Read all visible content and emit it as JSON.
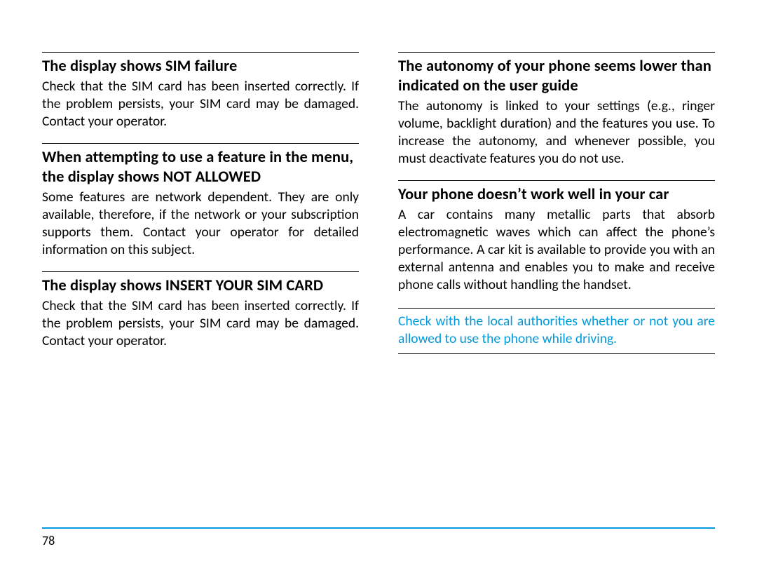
{
  "page_number": "78",
  "left": {
    "sections": [
      {
        "heading": "The display shows SIM failure",
        "body": "Check that the SIM card has been inserted correctly. If the problem persists, your SIM card may be damaged. Contact your operator."
      },
      {
        "heading": "When attempting to use a feature in the menu, the display shows NOT ALLOWED",
        "body": "Some features are network dependent. They are only available, therefore, if the network or your subscription supports them. Contact your operator for detailed information on this subject."
      },
      {
        "heading": "The display shows INSERT YOUR SIM CARD",
        "body": "Check that the SIM card has been inserted correctly. If the problem persists, your SIM card may be damaged. Contact your operator."
      }
    ]
  },
  "right": {
    "sections": [
      {
        "heading": "The autonomy of your phone seems lower than indicated on the user guide",
        "body": "The autonomy is linked to your settings (e.g., ringer volume, backlight duration) and the features you use. To increase the autonomy, and whenever possible, you must deactivate features you do not use."
      },
      {
        "heading": "Your phone doesn’t work well in your car",
        "body": "A car contains many metallic parts that absorb electromagnetic waves which can affect the phone’s performance. A car kit is available to provide you with an external antenna and enables you to make and receive phone calls without handling the handset."
      }
    ],
    "note": "Check with the local authorities whether or not you are allowed to use the phone while driving."
  }
}
